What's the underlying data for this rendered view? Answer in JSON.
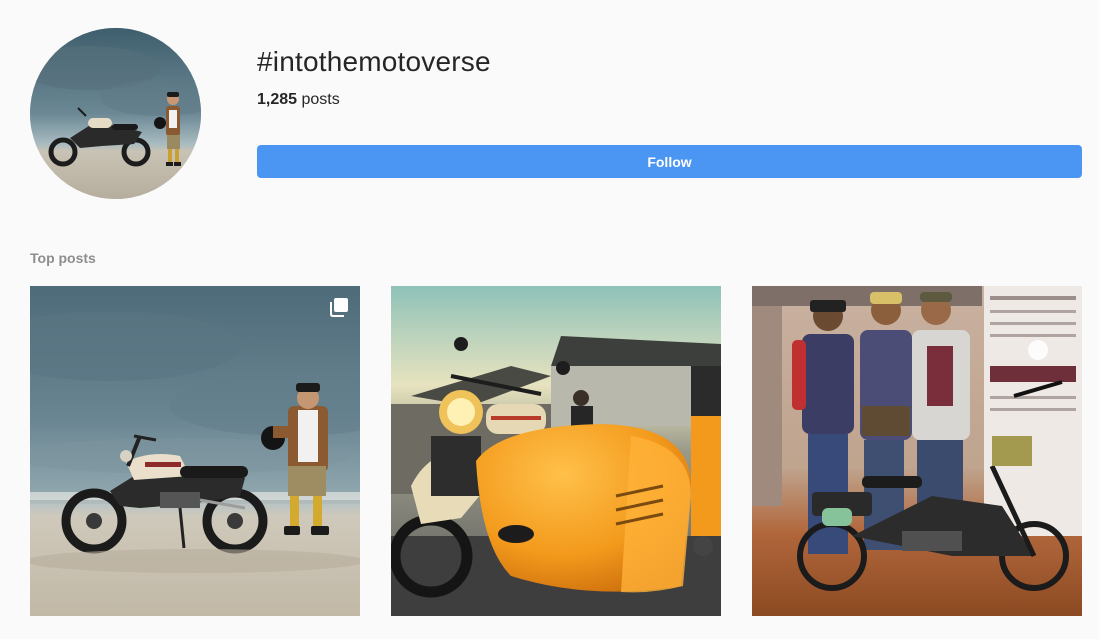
{
  "header": {
    "hashtag": "#intothemotoverse",
    "post_count": "1,285",
    "post_count_suffix": "posts",
    "follow_label": "Follow"
  },
  "top_posts": {
    "title": "Top posts",
    "posts": [
      {
        "icon": "multiple-photos-icon"
      },
      {},
      {}
    ]
  },
  "colors": {
    "follow_button": "#4b96f3",
    "background": "#fafafa",
    "section_title": "#8e8e8e"
  }
}
